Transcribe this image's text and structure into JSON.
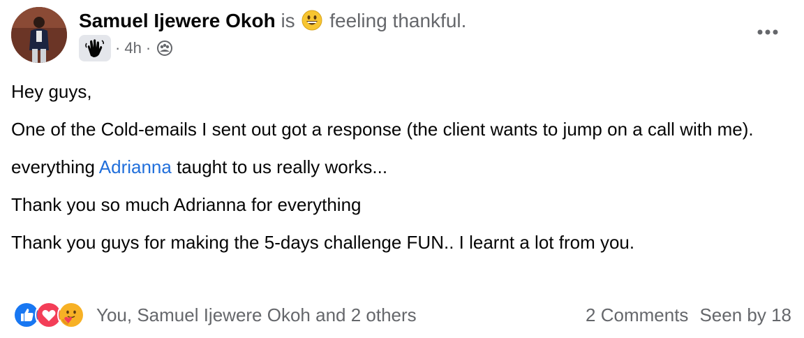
{
  "author": {
    "name": "Samuel Ijewere Okoh",
    "activity_prefix": "is",
    "activity": "feeling thankful."
  },
  "meta": {
    "dot1": "·",
    "time": "4h",
    "dot2": "·",
    "group_badge_icon": "waving-hand-icon",
    "audience_icon": "group-members-icon"
  },
  "post": {
    "greeting": "Hey guys,",
    "line1": "One of the Cold-emails I sent out got a response (the client wants to jump on a call with me).",
    "line2_before": "everything",
    "mention": "Adrianna",
    "line2_after": "taught to us really works...",
    "line3": "Thank you so much Adrianna for everything",
    "line4": "Thank you guys for making the 5-days challenge FUN.. I learnt a lot from you."
  },
  "footer": {
    "reaction_icons": [
      "like-icon",
      "love-icon",
      "care-icon"
    ],
    "reactors": "You, Samuel Ijewere Okoh and 2 others",
    "comments": "2 Comments",
    "seen": "Seen by 18"
  },
  "colors": {
    "text": "#050505",
    "muted": "#65676b",
    "mention": "#216fdb",
    "like": "#1877f2",
    "love": "#f33e58",
    "care": "#f7b125"
  }
}
